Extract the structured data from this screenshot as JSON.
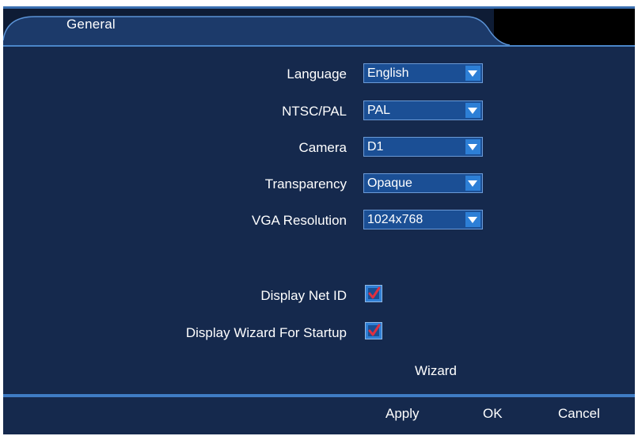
{
  "header": {
    "title": "General"
  },
  "settings": {
    "language": {
      "label": "Language",
      "value": "English"
    },
    "ntsc_pal": {
      "label": "NTSC/PAL",
      "value": "PAL"
    },
    "camera": {
      "label": "Camera",
      "value": "D1"
    },
    "transparency": {
      "label": "Transparency",
      "value": "Opaque"
    },
    "vga_resolution": {
      "label": "VGA Resolution",
      "value": "1024x768"
    }
  },
  "options": {
    "display_net_id": {
      "label": "Display Net ID",
      "checked": true
    },
    "display_wizard": {
      "label": "Display Wizard For Startup",
      "checked": true
    }
  },
  "wizard_label": "Wizard",
  "footer": {
    "apply": "Apply",
    "ok": "OK",
    "cancel": "Cancel"
  },
  "colors": {
    "background": "#15294d",
    "accent": "#2d7fd6",
    "checkmark": "#e03040"
  },
  "icons": {
    "dropdown": "chevron-down-icon",
    "checkbox": "checkmark-icon"
  }
}
